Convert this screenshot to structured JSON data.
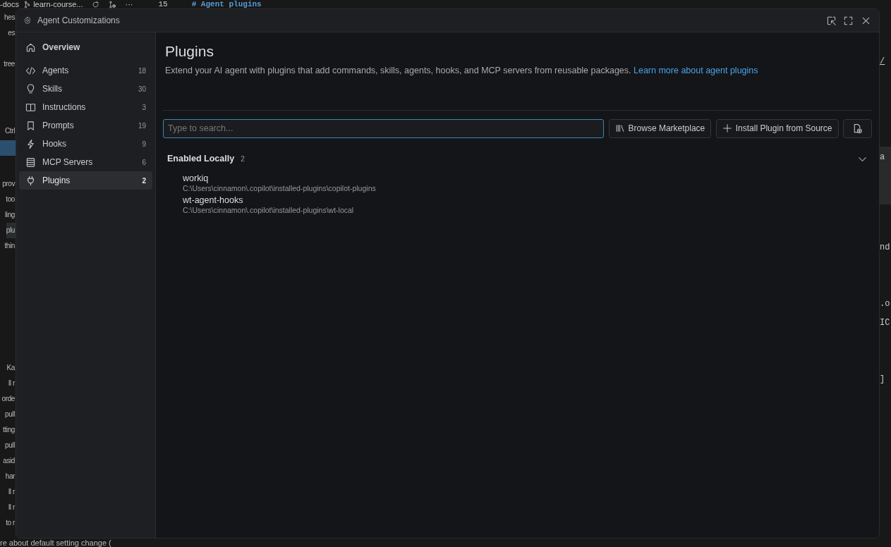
{
  "background": {
    "top_bar": {
      "repo": "-docs",
      "branch": "learn-course...",
      "more": "···",
      "line_number": "15",
      "heading": "# Agent plugins"
    },
    "left_groups": [
      {
        "lines": [
          {
            "text": "hes",
            "selected": false
          },
          {
            "text": "es",
            "selected": false
          }
        ]
      },
      {
        "lines": [
          {
            "text": "tree",
            "selected": false
          }
        ]
      },
      {
        "lines": [
          {
            "text": "Ctrl",
            "selected": false
          }
        ]
      },
      {
        "lines": [
          {
            "text": "prov",
            "selected": false
          },
          {
            "text": "too",
            "selected": false
          },
          {
            "text": "ling",
            "selected": false
          },
          {
            "text": "plu",
            "selected": true
          },
          {
            "text": "thin",
            "selected": false
          }
        ]
      },
      {
        "lines": [
          {
            "text": "Ka",
            "selected": false
          },
          {
            "text": "ll r",
            "selected": false
          },
          {
            "text": "orde",
            "selected": false
          },
          {
            "text": "pull",
            "selected": false
          },
          {
            "text": "tting",
            "selected": false
          },
          {
            "text": "pull",
            "selected": false
          },
          {
            "text": "asid",
            "selected": false
          },
          {
            "text": "har",
            "selected": false
          },
          {
            "text": "ll r",
            "selected": false
          },
          {
            "text": "ll r",
            "selected": false
          },
          {
            "text": "to r",
            "selected": false
          }
        ]
      }
    ],
    "right_fragments": [
      "/",
      "a",
      "nd",
      ".o",
      "IC",
      "]"
    ],
    "bottom_line": "re about default setting change ("
  },
  "window": {
    "title": "Agent Customizations"
  },
  "sidebar": {
    "items": [
      {
        "label": "Overview",
        "selected": false
      },
      {
        "label": "Agents",
        "count": "18",
        "selected": false
      },
      {
        "label": "Skills",
        "count": "30",
        "selected": false
      },
      {
        "label": "Instructions",
        "count": "3",
        "selected": false
      },
      {
        "label": "Prompts",
        "count": "19",
        "selected": false
      },
      {
        "label": "Hooks",
        "count": "9",
        "selected": false
      },
      {
        "label": "MCP Servers",
        "count": "6",
        "selected": false
      },
      {
        "label": "Plugins",
        "count": "2",
        "selected": true
      }
    ]
  },
  "page": {
    "title": "Plugins",
    "description": "Extend your AI agent with plugins that add commands, skills, agents, hooks, and MCP servers from reusable packages.",
    "link": "Learn more about agent plugins",
    "search": {
      "placeholder": "Type to search..."
    },
    "buttons": [
      {
        "label": "Browse Marketplace"
      },
      {
        "label": "Install Plugin from Source"
      }
    ],
    "section": {
      "title": "Enabled Locally",
      "count": "2",
      "expanded": true,
      "plugins": [
        {
          "name": "workiq",
          "path": "C:\\Users\\cinnamon\\.copilot\\installed-plugins\\copilot-plugins"
        },
        {
          "name": "wt-agent-hooks",
          "path": "C:\\Users\\cinnamon\\.copilot\\installed-plugins\\wt-local"
        }
      ]
    }
  }
}
